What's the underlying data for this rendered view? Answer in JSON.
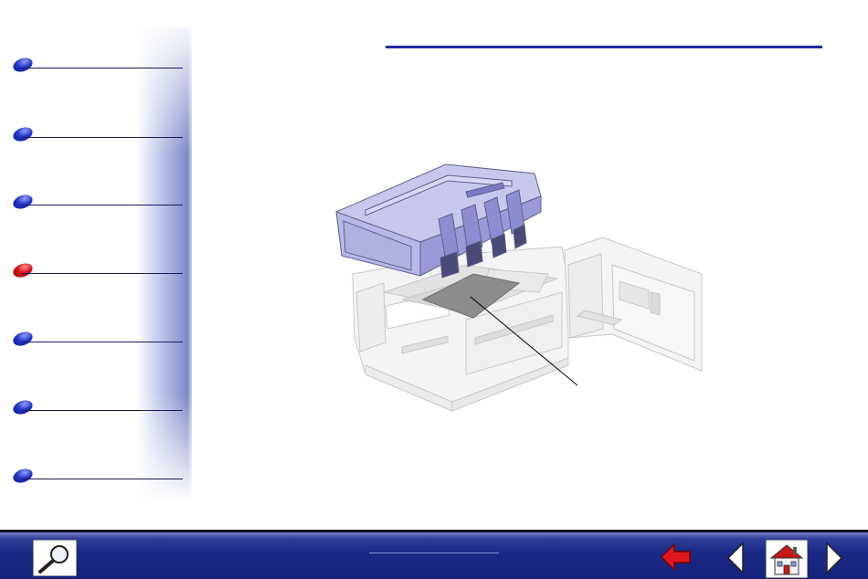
{
  "sidebar": {
    "items": [
      {
        "label": "",
        "active": false
      },
      {
        "label": "",
        "active": false
      },
      {
        "label": "",
        "active": false
      },
      {
        "label": "",
        "active": true
      },
      {
        "label": "",
        "active": false
      },
      {
        "label": "",
        "active": false
      },
      {
        "label": "",
        "active": false
      }
    ]
  },
  "main": {
    "title": "",
    "callout_label": ""
  },
  "toolbar": {
    "page_label": "",
    "icons": [
      "magnifier-icon",
      "back-arrow-icon",
      "previous-page-icon",
      "home-icon",
      "next-page-icon"
    ]
  },
  "colors": {
    "nav_blue": "#1e2a9c",
    "active_red": "#d0101a",
    "toolbar_blue": "#1b2a86"
  }
}
